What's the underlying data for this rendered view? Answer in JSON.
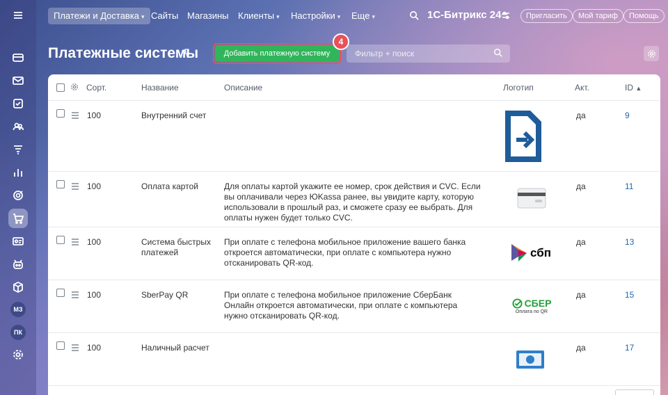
{
  "topbar": {
    "menu": [
      {
        "label": "Платежи и Доставка",
        "chevron": true,
        "active": true
      },
      {
        "label": "Сайты",
        "chevron": false
      },
      {
        "label": "Магазины",
        "chevron": false
      },
      {
        "label": "Клиенты",
        "chevron": true
      },
      {
        "label": "Настройки",
        "chevron": true
      },
      {
        "label": "Еще",
        "chevron": true
      }
    ],
    "brand": "1С-Битрикс",
    "brand_suffix": "24",
    "invite": "Пригласить",
    "tariff": "Мой тариф",
    "help": "Помощь"
  },
  "sidebar": {
    "avatars": [
      "МЗ",
      "ПК"
    ]
  },
  "page": {
    "title": "Платежные системы",
    "add_button": "Добавить платежную систему",
    "step_badge": "4",
    "filter_placeholder": "Фильтр + поиск"
  },
  "table": {
    "headers": {
      "sort": "Сорт.",
      "name": "Название",
      "description": "Описание",
      "logo": "Логотип",
      "active": "Акт.",
      "id": "ID"
    },
    "rows": [
      {
        "sort": "100",
        "name": "Внутренний счет",
        "name2": "",
        "desc": "",
        "active": "да",
        "id": "9",
        "logo": "doc-arrow-logo"
      },
      {
        "sort": "100",
        "name": "Оплата картой",
        "name2": "",
        "desc": "Для оплаты картой укажите ее номер, срок действия и CVC. Если вы оплачивали через ЮKassa ранее, вы увидите карту, которую использовали в прошлый раз, и сможете сразу ее выбрать. Для оплаты нужен будет только CVC.",
        "active": "да",
        "id": "11",
        "logo": "bank-card-logo"
      },
      {
        "sort": "100",
        "name": "Система быстрых",
        "name2": "платежей",
        "desc": "При оплате с телефона мобильное приложение вашего банка откроется автоматически, при оплате с компьютера нужно отсканировать QR-код.",
        "active": "да",
        "id": "13",
        "logo": "sbp-logo",
        "logo_text": "сбп"
      },
      {
        "sort": "100",
        "name": "SberPay QR",
        "name2": "",
        "desc": "При оплате с телефона мобильное приложение СберБанк Онлайн откроется автоматически, при оплате с компьютера нужно отсканировать QR-код.",
        "active": "да",
        "id": "15",
        "logo": "sber-logo",
        "logo_text": "СБЕР",
        "logo_sub": "Оплата по QR"
      },
      {
        "sort": "100",
        "name": "Наличный расчет",
        "name2": "",
        "desc": "",
        "active": "да",
        "id": "17",
        "logo": "cash-logo"
      }
    ]
  },
  "colors": {
    "accent_green": "#30b55a",
    "highlight_red": "#e8515a",
    "link_blue": "#2067b0",
    "sber_green": "#21a038"
  }
}
